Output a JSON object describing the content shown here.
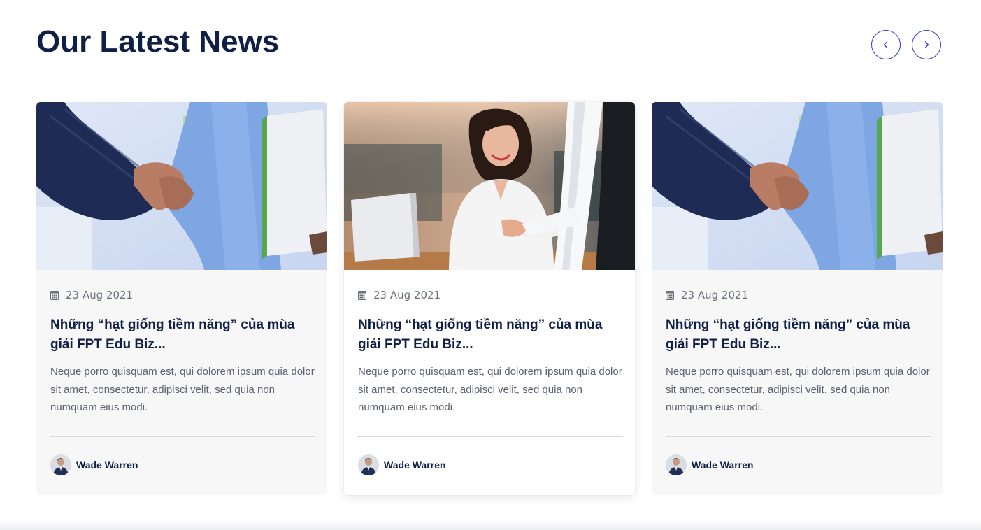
{
  "section": {
    "title": "Our Latest News",
    "nav": {
      "prev_icon": "chevron-left-icon",
      "next_icon": "chevron-right-icon",
      "accent_color": "#2f3bd0"
    }
  },
  "cards": [
    {
      "image": "handshake-clipboard-photo",
      "date_icon": "calendar-icon",
      "date": "23 Aug 2021",
      "title": "Những “hạt giống tiềm năng” của mùa giải FPT Edu Biz...",
      "excerpt": "Neque porro quisquam est, qui dolorem ipsum quia dolor sit amet, consectetur, adipisci velit, sed quia non numquam eius modi.",
      "author": "Wade Warren"
    },
    {
      "image": "smiling-woman-handshake-photo",
      "date_icon": "calendar-icon",
      "date": "23 Aug 2021",
      "title": "Những “hạt giống tiềm năng” của mùa giải FPT Edu Biz...",
      "excerpt": "Neque porro quisquam est, qui dolorem ipsum quia dolor sit amet, consectetur, adipisci velit, sed quia non numquam eius modi.",
      "author": "Wade Warren"
    },
    {
      "image": "handshake-clipboard-photo",
      "date_icon": "calendar-icon",
      "date": "23 Aug 2021",
      "title": "Những “hạt giống tiềm năng” của mùa giải FPT Edu Biz...",
      "excerpt": "Neque porro quisquam est, qui dolorem ipsum quia dolor sit amet, consectetur, adipisci velit, sed quia non numquam eius modi.",
      "author": "Wade Warren"
    }
  ],
  "colors": {
    "heading": "#0f1f45",
    "body_text": "#5c6070",
    "card_bg": "#f7f7f7"
  }
}
